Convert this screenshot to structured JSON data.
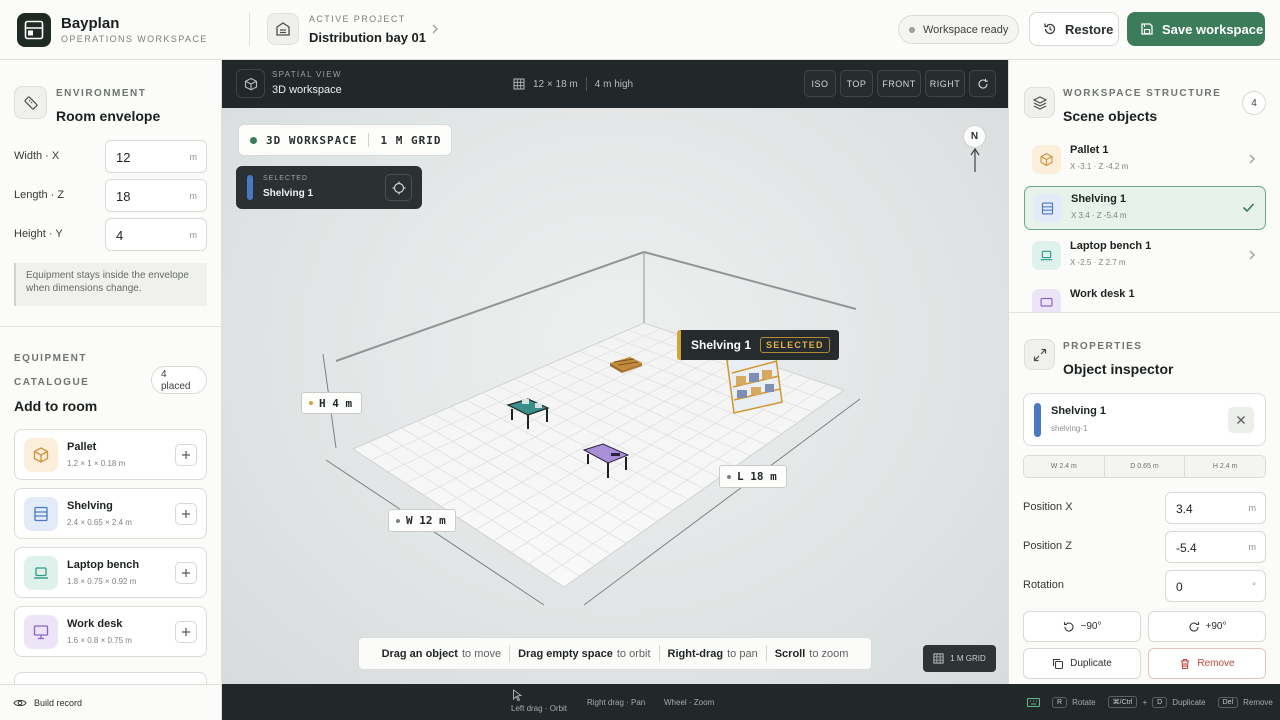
{
  "header": {
    "brand": "Bayplan",
    "brand_sub": "OPERATIONS WORKSPACE",
    "project_label": "ACTIVE PROJECT",
    "project_name": "Distribution bay 01",
    "status": "Workspace ready",
    "restore_label": "Restore",
    "save_label": "Save workspace",
    "accent": "#3d7c5a"
  },
  "environment": {
    "label": "ENVIRONMENT",
    "title": "Room envelope",
    "fields": [
      {
        "label": "Width · X",
        "value": "12",
        "unit": "m"
      },
      {
        "label": "Length · Z",
        "value": "18",
        "unit": "m"
      },
      {
        "label": "Height · Y",
        "value": "4",
        "unit": "m"
      }
    ],
    "note": "Equipment stays inside the envelope when dimensions change."
  },
  "catalogue": {
    "label1": "EQUIPMENT",
    "label2": "CATALOGUE",
    "title": "Add to room",
    "badge_count": "4",
    "badge_text": "placed",
    "items": [
      {
        "name": "Pallet",
        "spec": "1.2 × 1 × 0.18 m",
        "icon": "box-icon",
        "color": "#d4923a"
      },
      {
        "name": "Shelving",
        "spec": "2.4 × 0.65 × 2.4 m",
        "icon": "shelving-icon",
        "color": "#4a78c3"
      },
      {
        "name": "Laptop bench",
        "spec": "1.8 × 0.75 × 0.92 m",
        "icon": "laptop-icon",
        "color": "#2f9a8a"
      },
      {
        "name": "Work desk",
        "spec": "1.6 × 0.8 × 0.75 m",
        "icon": "monitor-icon",
        "color": "#8a63c7"
      }
    ]
  },
  "viewport": {
    "label": "SPATIAL VIEW",
    "name": "3D workspace",
    "dims": "12 × 18 m",
    "height": "4 m high",
    "views": [
      "ISO",
      "TOP",
      "FRONT",
      "RIGHT"
    ],
    "chip_left": "3D WORKSPACE",
    "chip_right": "1 M GRID",
    "selected_label": "SELECTED",
    "selected_name": "Shelving 1",
    "compass": "N",
    "float_name": "Shelving 1",
    "float_tag": "SELECTED",
    "dim_h": "H 4 m",
    "dim_w": "W 12 m",
    "dim_l": "L 18 m",
    "hints": [
      {
        "b": "Drag an object",
        "t": "to move"
      },
      {
        "b": "Drag empty space",
        "t": "to orbit"
      },
      {
        "b": "Right-drag",
        "t": "to pan"
      },
      {
        "b": "Scroll",
        "t": "to zoom"
      }
    ],
    "grid_chip": "1 M GRID"
  },
  "structure": {
    "label": "WORKSPACE STRUCTURE",
    "title": "Scene objects",
    "count": "4",
    "objects": [
      {
        "name": "Pallet 1",
        "coords": "X -3.1 · Z -4.2 m"
      },
      {
        "name": "Shelving 1",
        "coords": "X 3.4 · Z -5.4 m"
      },
      {
        "name": "Laptop bench 1",
        "coords": "X -2.5 · Z 2.7 m"
      },
      {
        "name": "Work desk 1",
        "coords": ""
      }
    ]
  },
  "inspector": {
    "label": "PROPERTIES",
    "title": "Object inspector",
    "name": "Shelving 1",
    "id": "shelving-1",
    "dims": [
      "W 2.4 m",
      "D 0.65 m",
      "H 2.4 m"
    ],
    "pos_x_label": "Position X",
    "pos_x": "3.4",
    "pos_x_unit": "m",
    "pos_z_label": "Position Z",
    "pos_z": "-5.4",
    "pos_z_unit": "m",
    "rot_label": "Rotation",
    "rot": "0",
    "rot_unit": "°",
    "rot_ccw": "−90°",
    "rot_cw": "+90°",
    "duplicate": "Duplicate",
    "remove": "Remove"
  },
  "footer": {
    "build": "Build record",
    "left_drag": "Left drag · Orbit",
    "right_drag": "Right drag · Pan",
    "wheel": "Wheel · Zoom",
    "k_r": "R",
    "rotate": "Rotate",
    "k_ctrl": "⌘/Ctrl",
    "plus": "+",
    "k_d": "D",
    "duplicate": "Duplicate",
    "k_del": "Del",
    "remove": "Remove"
  }
}
